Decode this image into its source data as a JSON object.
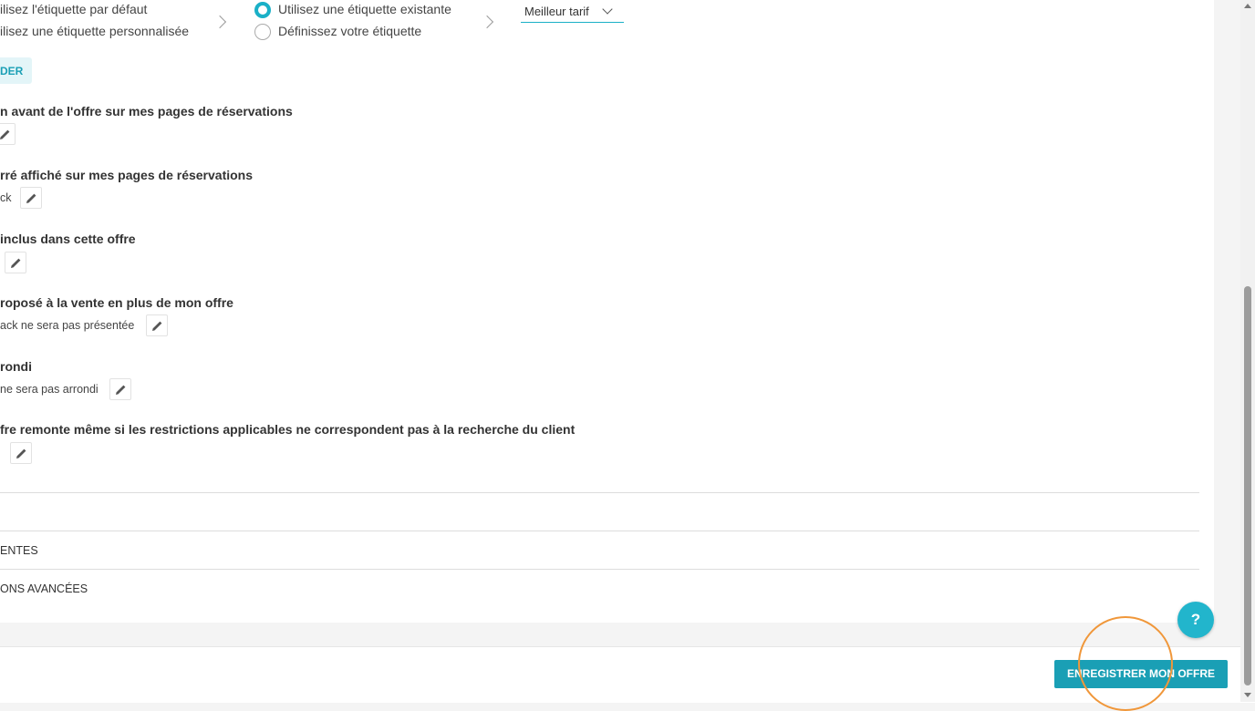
{
  "label_config": {
    "option_default": "ilisez l'étiquette par défaut",
    "option_custom": "ilisez une étiquette personnalisée",
    "option_existing": "Utilisez une étiquette existante",
    "option_define": "Définissez votre étiquette",
    "select_value": "Meilleur tarif",
    "validate_button": "DER"
  },
  "sections": [
    {
      "title": "n avant de l'offre sur mes pages de réservations",
      "value": ""
    },
    {
      "title": "rré affiché sur mes pages de réservations",
      "value": "ck"
    },
    {
      "title": "inclus dans cette offre",
      "value": ""
    },
    {
      "title": "roposé à la vente en plus de mon offre",
      "value": "ack ne sera pas présentée"
    },
    {
      "title": "rondi",
      "value": "ne sera pas arrondi"
    },
    {
      "title": "fre remonte même si les restrictions applicables ne correspondent pas à la recherche du client",
      "value": ""
    }
  ],
  "accordions": [
    {
      "label": ""
    },
    {
      "label": "ENTES"
    },
    {
      "label": "ONS AVANCÉES"
    }
  ],
  "footer": {
    "save_label": "ENREGISTRER MON OFFRE",
    "help_label": "?"
  },
  "colors": {
    "accent": "#1ab0c7",
    "button": "#1a9fb5",
    "highlight_ring": "#f0973a"
  }
}
